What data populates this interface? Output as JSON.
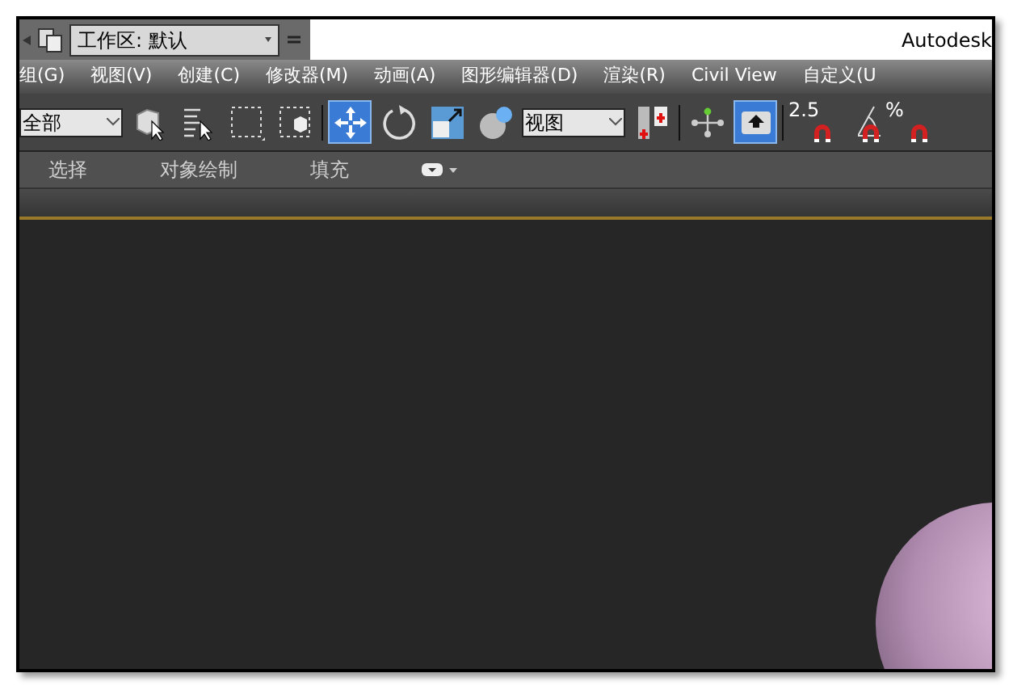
{
  "title_bar": {
    "workspace": "工作区: 默认",
    "app_title": "Autodesk"
  },
  "menu": [
    "组(G)",
    "视图(V)",
    "创建(C)",
    "修改器(M)",
    "动画(A)",
    "图形编辑器(D)",
    "渲染(R)",
    "Civil View",
    "自定义(U"
  ],
  "toolbar": [
    {
      "kind": "dropdown",
      "value": "全部"
    },
    {
      "kind": "tool",
      "selected": false
    },
    {
      "kind": "tool",
      "selected": false
    },
    {
      "kind": "tool",
      "selected": false
    },
    {
      "kind": "tool",
      "selected": false
    },
    {
      "kind": "separator"
    },
    {
      "kind": "tool",
      "selected": true
    },
    {
      "kind": "tool",
      "selected": false
    },
    {
      "kind": "tool",
      "selected": false
    },
    {
      "kind": "tool",
      "selected": false
    },
    {
      "kind": "dropdown",
      "value": "视图"
    },
    {
      "kind": "tool",
      "selected": false
    },
    {
      "kind": "separator"
    },
    {
      "kind": "tool",
      "selected": false
    },
    {
      "kind": "tool",
      "selected": true
    },
    {
      "kind": "separator"
    },
    {
      "kind": "snap",
      "label": "2.5"
    },
    {
      "kind": "snap"
    },
    {
      "kind": "snap",
      "label": "%"
    }
  ],
  "ribbon_tabs": [
    "选择",
    "对象绘制",
    "填充"
  ]
}
